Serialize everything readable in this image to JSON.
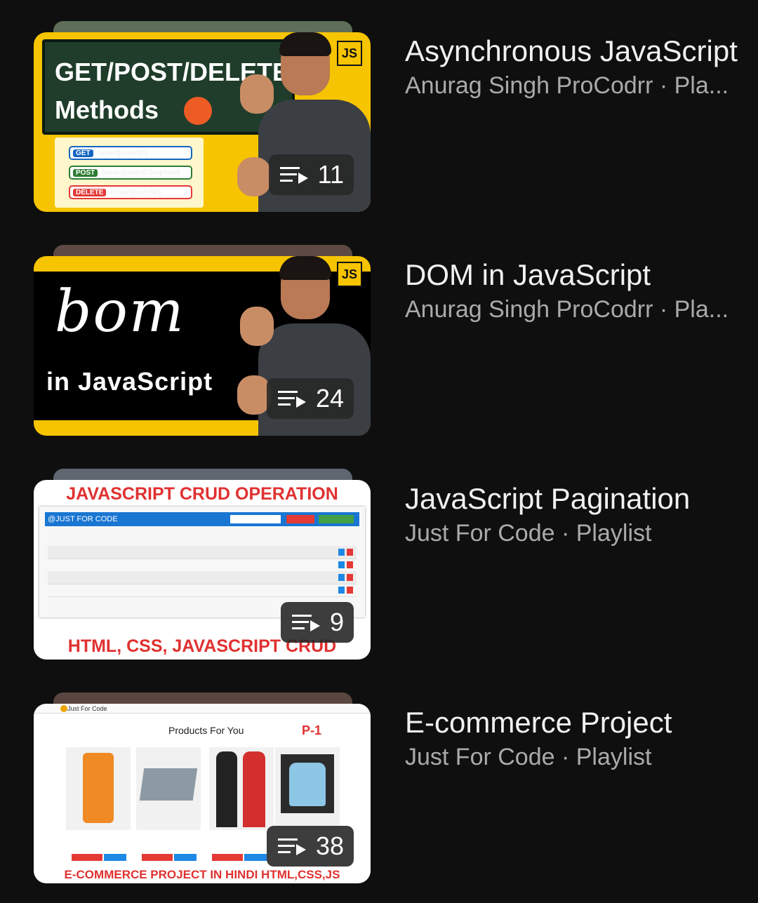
{
  "playlists": [
    {
      "title": "Asynchronous JavaScript",
      "subtitle": "Anurag Singh ProCodrr · Pla...",
      "video_count": "11",
      "stack_color": "#5e6e58",
      "thumb_text": {
        "line1": "GET/POST/DELETE",
        "line2": "Methods",
        "badge": "JS",
        "requests": [
          {
            "method": "GET",
            "path": "/user/{userID}",
            "color": "#1565c0"
          },
          {
            "method": "POST",
            "path": "/user/{userID}/upload",
            "color": "#2e7d32"
          },
          {
            "method": "DELETE",
            "path": "/user/{userID}",
            "color": "#e53935"
          }
        ]
      }
    },
    {
      "title": "DOM in JavaScript",
      "subtitle": "Anurag Singh ProCodrr · Pla...",
      "video_count": "24",
      "stack_color": "#5e4a45",
      "thumb_text": {
        "line1": "bom",
        "line2": "in JavaScript",
        "badge": "JS"
      }
    },
    {
      "title": "JavaScript Pagination",
      "subtitle": "Just For Code · Playlist",
      "video_count": "9",
      "stack_color": "#5f6670",
      "thumb_text": {
        "line1": "JAVASCRIPT CRUD OPERATION",
        "line2": "HTML, CSS, JAVASCRIPT CRUD",
        "app_title": "@JUST FOR CODE"
      }
    },
    {
      "title": "E-commerce Project",
      "subtitle": "Just For Code · Playlist",
      "video_count": "38",
      "stack_color": "#5a4640",
      "thumb_text": {
        "brand": "Just For Code",
        "heading": "Products For You",
        "page": "P-1",
        "footer": "E-COMMERCE PROJECT IN HINDI HTML,CSS,JS"
      }
    }
  ],
  "icons": {
    "playlist": "playlist-play-icon"
  }
}
